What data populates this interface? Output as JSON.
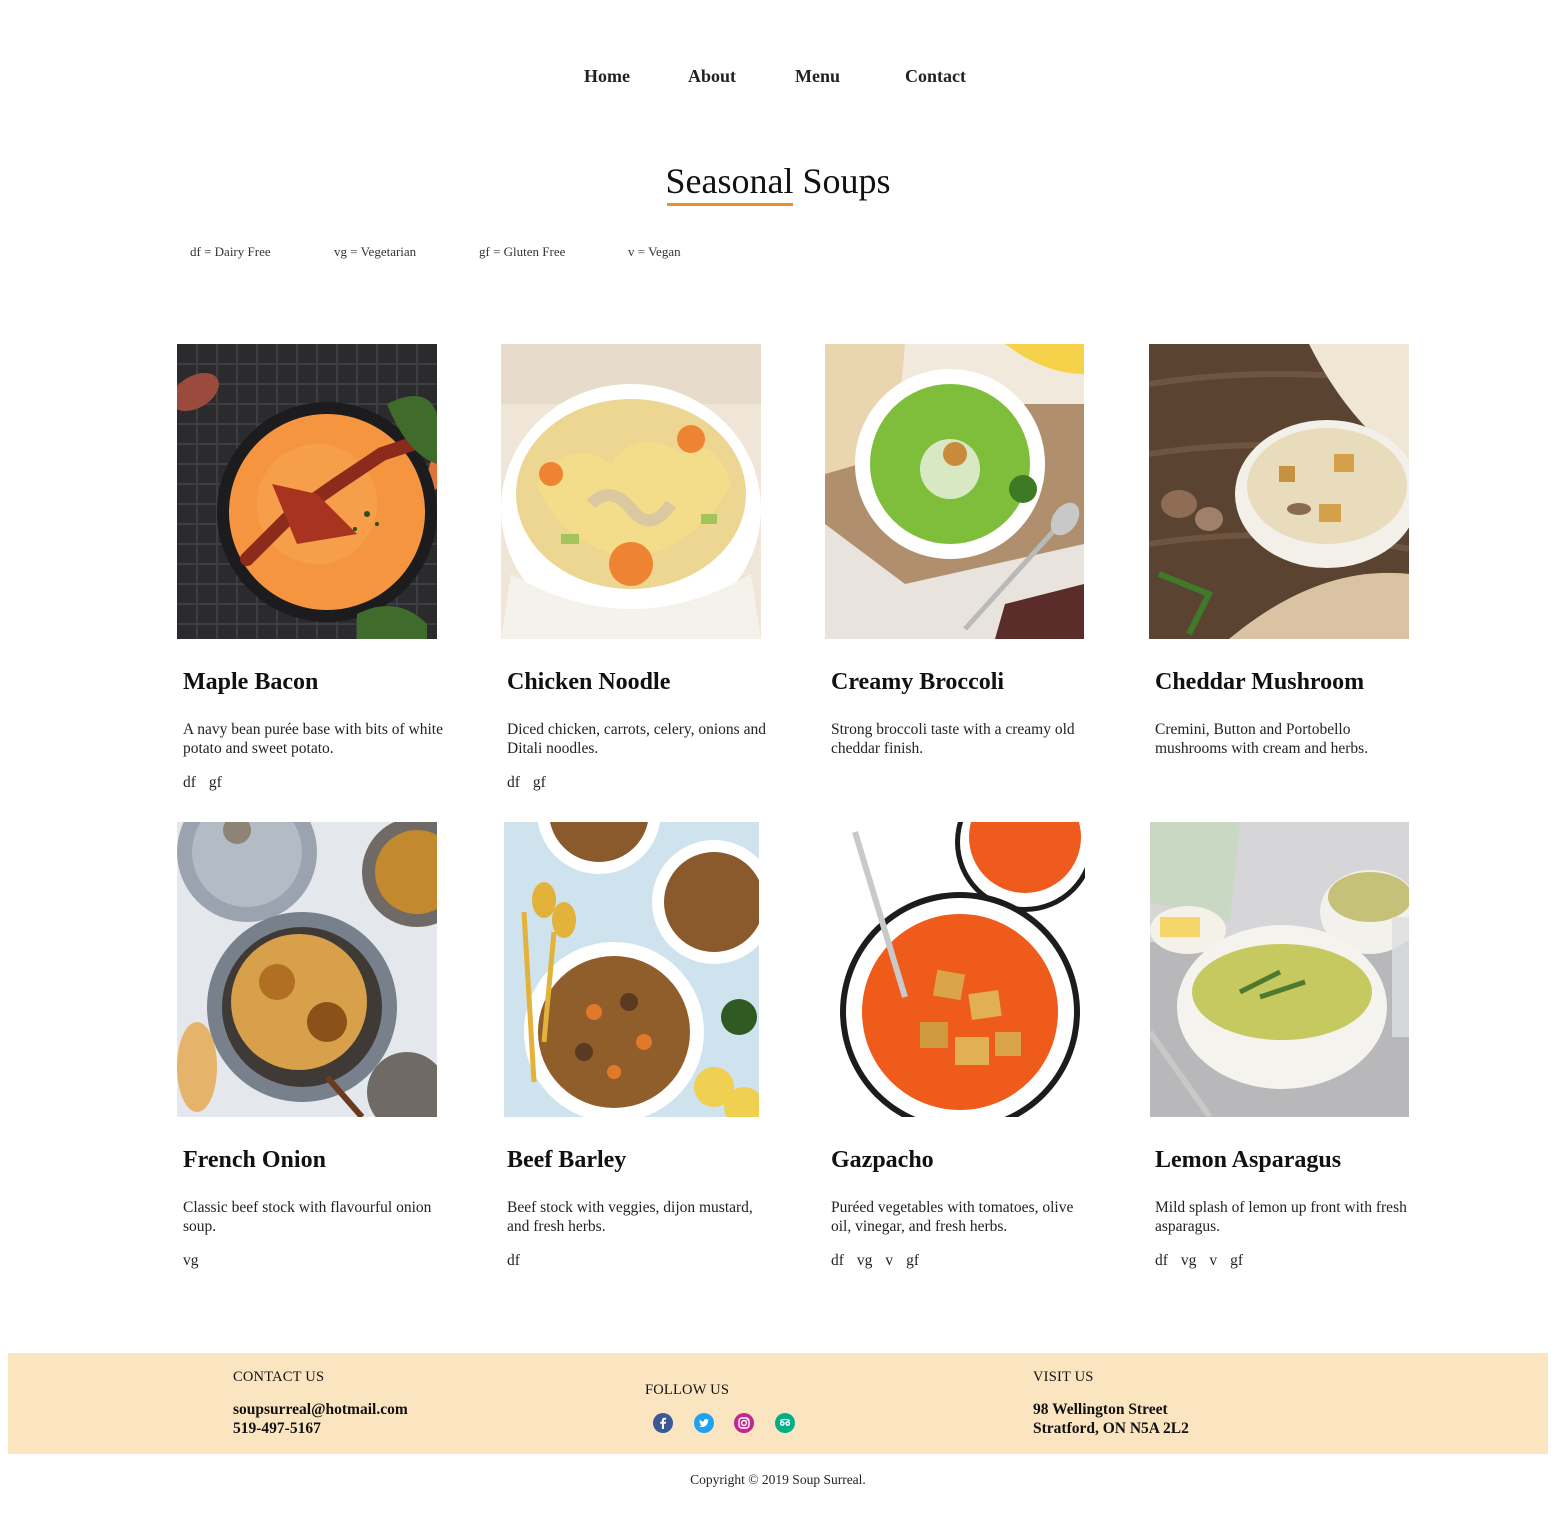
{
  "nav": {
    "home": "Home",
    "about": "About",
    "menu": "Menu",
    "contact": "Contact"
  },
  "page": {
    "title": "Seasonal Soups",
    "accent_color": "#f08c2a"
  },
  "legend": {
    "df": "df = Dairy Free",
    "vg": "vg = Vegetarian",
    "gf": "gf = Gluten Free",
    "v": "v = Vegan"
  },
  "soups": [
    {
      "name": "Maple Bacon",
      "desc": "A navy bean purée base with bits of white potato and sweet potato.",
      "tags": [
        "df",
        "gf"
      ]
    },
    {
      "name": "Chicken Noodle",
      "desc": "Diced chicken, carrots, celery, onions and Ditali noodles.",
      "tags": [
        "df",
        "gf"
      ]
    },
    {
      "name": "Creamy Broccoli",
      "desc": "Strong broccoli taste with a creamy old cheddar finish.",
      "tags": []
    },
    {
      "name": "Cheddar Mushroom",
      "desc": "Cremini, Button and Portobello mushrooms with cream and herbs.",
      "tags": []
    },
    {
      "name": "French Onion",
      "desc": "Classic beef stock with flavourful onion soup.",
      "tags": [
        "vg"
      ]
    },
    {
      "name": "Beef Barley",
      "desc": "Beef stock with veggies, dijon mustard, and fresh herbs.",
      "tags": [
        "df"
      ]
    },
    {
      "name": "Gazpacho",
      "desc": "Puréed vegetables with tomatoes, olive oil, vinegar, and fresh herbs.",
      "tags": [
        "df",
        "vg",
        "v",
        "gf"
      ]
    },
    {
      "name": "Lemon Asparagus",
      "desc": "Mild splash of lemon up front with fresh asparagus.",
      "tags": [
        "df",
        "vg",
        "v",
        "gf"
      ]
    }
  ],
  "footer": {
    "contact_heading": "CONTACT US",
    "email": "soupsurreal@hotmail.com",
    "phone": "519-497-5167",
    "follow_heading": "FOLLOW US",
    "visit_heading": "VISIT US",
    "address_line1": "98 Wellington Street",
    "address_line2": "Stratford, ON N5A 2L2",
    "background_color": "#fbe5c1",
    "social_icons": [
      "facebook-icon",
      "twitter-icon",
      "instagram-icon",
      "tripadvisor-icon"
    ]
  },
  "copyright": "Copyright © 2019 Soup Surreal."
}
